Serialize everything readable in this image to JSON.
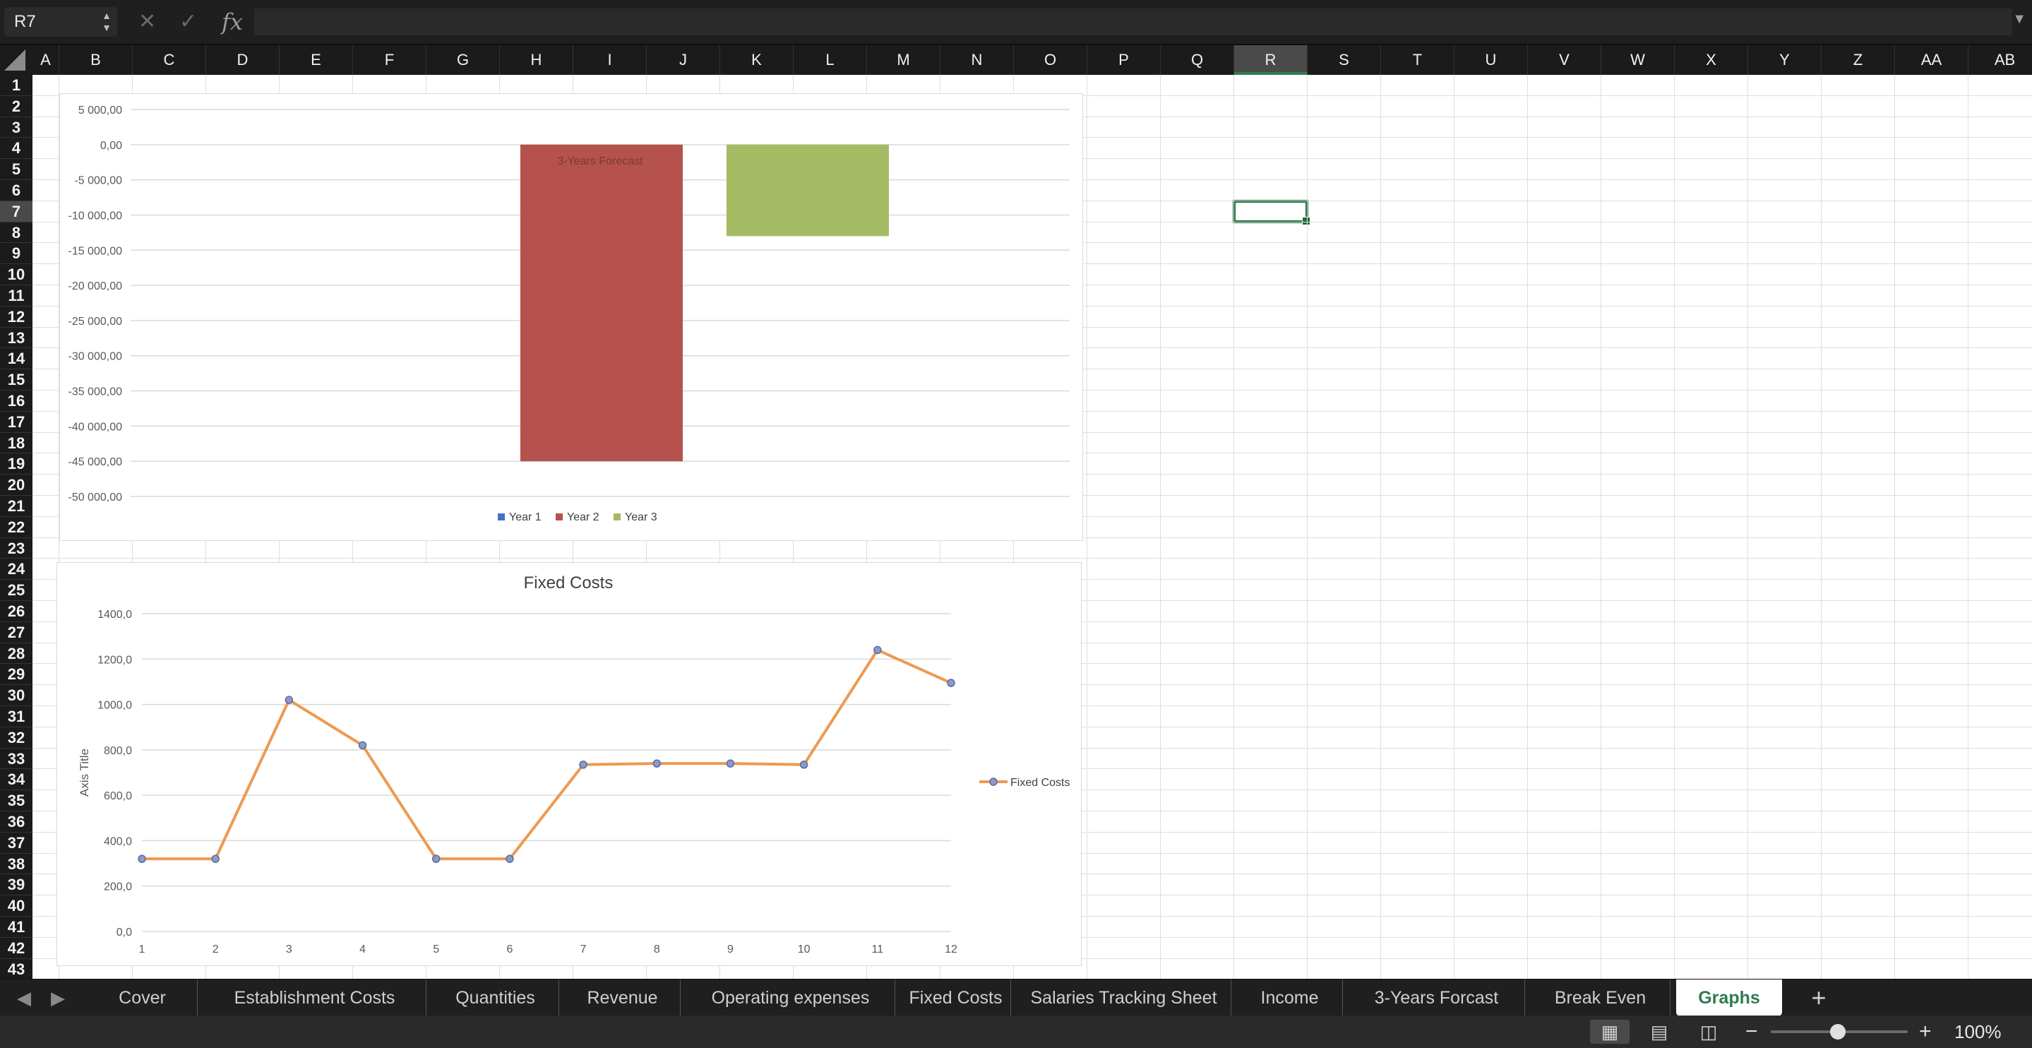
{
  "formula_bar": {
    "cell_ref": "R7",
    "fx_label": "fx",
    "cancel_icon": "x-icon",
    "confirm_icon": "check-icon",
    "formula": ""
  },
  "columns": [
    "A",
    "B",
    "C",
    "D",
    "E",
    "F",
    "G",
    "H",
    "I",
    "J",
    "K",
    "L",
    "M",
    "N",
    "O",
    "P",
    "Q",
    "R",
    "S",
    "T",
    "U",
    "V",
    "W",
    "X",
    "Y",
    "Z",
    "AA",
    "AB"
  ],
  "rows": [
    "1",
    "2",
    "3",
    "4",
    "5",
    "6",
    "7",
    "8",
    "9",
    "10",
    "11",
    "12",
    "13",
    "14",
    "15",
    "16",
    "17",
    "18",
    "19",
    "20",
    "21",
    "22",
    "23",
    "24",
    "25",
    "26",
    "27",
    "28",
    "29",
    "30",
    "31",
    "32",
    "33",
    "34",
    "35",
    "36",
    "37",
    "38",
    "39",
    "40",
    "41",
    "42",
    "43"
  ],
  "selected_cell": {
    "column": "R",
    "row": "7"
  },
  "tabs": [
    {
      "label": "Cover"
    },
    {
      "label": "Establishment  Costs"
    },
    {
      "label": "Quantities"
    },
    {
      "label": "Revenue"
    },
    {
      "label": "Operating expenses"
    },
    {
      "label": "Fixed Costs"
    },
    {
      "label": "Salaries Tracking Sheet"
    },
    {
      "label": "Income"
    },
    {
      "label": "3-Years Forcast"
    },
    {
      "label": "Break Even"
    },
    {
      "label": "Graphs",
      "active": true
    }
  ],
  "status": {
    "zoom": "100%"
  },
  "colors": {
    "accent": "#2e7d4f",
    "year1": "#4472c4",
    "year2": "#b5524d",
    "year3": "#a4bb64",
    "fixed_costs": "#ed9a52"
  },
  "chart_data": [
    {
      "type": "bar",
      "title": "3-Years Forecast",
      "categories": [
        ""
      ],
      "series": [
        {
          "name": "Year 1",
          "values": [
            0
          ]
        },
        {
          "name": "Year 2",
          "values": [
            -45000
          ]
        },
        {
          "name": "Year 3",
          "values": [
            -13000
          ]
        }
      ],
      "ylim": [
        -50000,
        5000
      ],
      "yticks": [
        "5 000,00",
        "0,00",
        "-5 000,00",
        "-10 000,00",
        "-15 000,00",
        "-20 000,00",
        "-25 000,00",
        "-30 000,00",
        "-35 000,00",
        "-40 000,00",
        "-45 000,00",
        "-50 000,00"
      ],
      "grid": true,
      "legend": "bottom"
    },
    {
      "type": "line",
      "title": "Fixed Costs",
      "ylabel": "Axis Title",
      "x": [
        1,
        2,
        3,
        4,
        5,
        6,
        7,
        8,
        9,
        10,
        11,
        12
      ],
      "series": [
        {
          "name": "Fixed Costs",
          "values": [
            320,
            320,
            1020,
            820,
            320,
            320,
            735,
            740,
            740,
            735,
            1240,
            1095
          ]
        }
      ],
      "ylim": [
        0,
        1400
      ],
      "yticks": [
        "0,0",
        "200,0",
        "400,0",
        "600,0",
        "800,0",
        "1000,0",
        "1200,0",
        "1400,0"
      ],
      "grid": true,
      "legend": "right"
    }
  ]
}
